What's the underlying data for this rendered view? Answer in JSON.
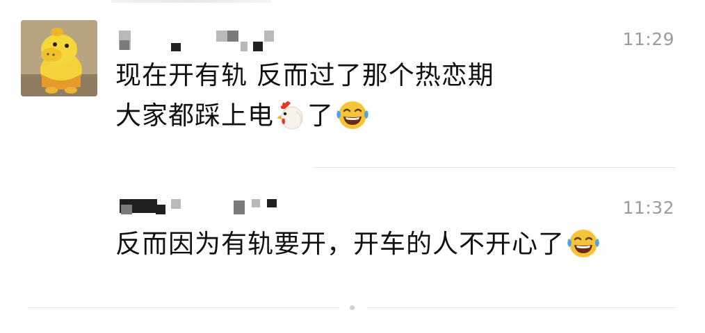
{
  "messages": [
    {
      "time": "11:29",
      "lines": [
        "现在开有轨 反而过了那个热恋期",
        "大家都踩上电",
        "了"
      ],
      "emojis": [
        "rooster-icon",
        "tears-of-joy-icon"
      ]
    },
    {
      "time": "11:32",
      "lines": [
        "反而因为有轨要开，开车的人不开心了"
      ],
      "emojis": [
        "tears-of-joy-icon"
      ]
    }
  ],
  "colors": {
    "timestamp": "#9b9b9b",
    "text": "#111111",
    "divider": "#e4e4e4",
    "emoji_face": "#f7c437"
  }
}
